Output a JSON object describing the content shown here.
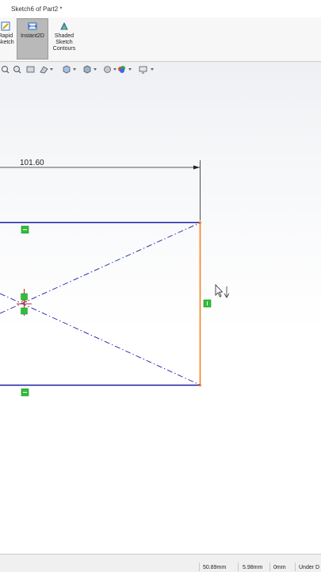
{
  "window": {
    "title": "Sketch6 of Part2 *"
  },
  "ribbon": {
    "rapid_sketch": {
      "line1": "Rapid",
      "line2": "Sketch"
    },
    "instant2d": {
      "label": "Instant2D"
    },
    "shaded_contours": {
      "line1": "Shaded",
      "line2": "Sketch",
      "line3": "Contours"
    }
  },
  "sketch": {
    "dimension_value": "101.60",
    "line_color": "#1f1fa8",
    "selected_edge_color": "#f58220",
    "relation_color": "#2fbf3a"
  },
  "statusbar": {
    "x": "50.89mm",
    "y": "5.98mm",
    "z": "0mm",
    "state": "Under D"
  }
}
